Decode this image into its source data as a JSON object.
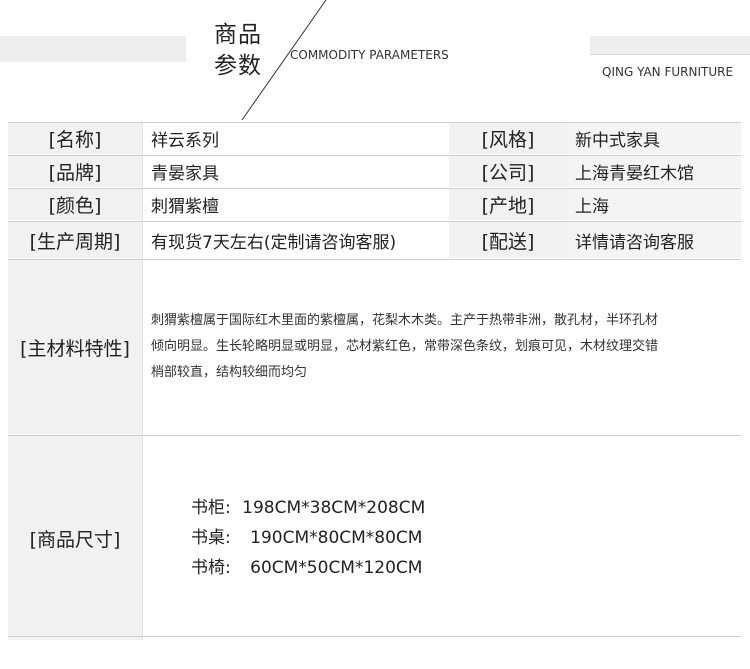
{
  "header": {
    "title_line1": "商品",
    "title_line2": "参数",
    "title_en": "COMMODITY PARAMETERS",
    "brand_en": "QING YAN FURNITURE"
  },
  "rows": [
    {
      "label1": "[名称]",
      "value1": "祥云系列",
      "label2": "[风格]",
      "value2": "新中式家具"
    },
    {
      "label1": "[品牌]",
      "value1": "青晏家具",
      "label2": "[公司]",
      "value2": "上海青晏红木馆"
    },
    {
      "label1": "[颜色]",
      "value1": "刺猬紫檀",
      "label2": "[产地]",
      "value2": "上海"
    },
    {
      "label1": "[生产周期]",
      "value1": "有现货7天左右(定制请咨询客服)",
      "label2": "[配送]",
      "value2": "详情请咨询客服"
    }
  ],
  "material": {
    "label": "[主材料特性]",
    "lines": [
      "刺猬紫檀属于国际红木里面的紫檀属，花梨木木类。主产于热带非洲，散孔材，半环孔材",
      "倾向明显。生长轮略明显或明显，芯材紫红色，常带深色条纹，划痕可见，木材纹理交错",
      "梢部较直，结构较细而均匀"
    ]
  },
  "size": {
    "label": "[商品尺寸]",
    "items": [
      {
        "name": "书柜:",
        "dims": "198CM*38CM*208CM"
      },
      {
        "name": "书桌:",
        "dims": "190CM*80CM*80CM"
      },
      {
        "name": "书椅:",
        "dims": "60CM*50CM*120CM"
      }
    ]
  }
}
